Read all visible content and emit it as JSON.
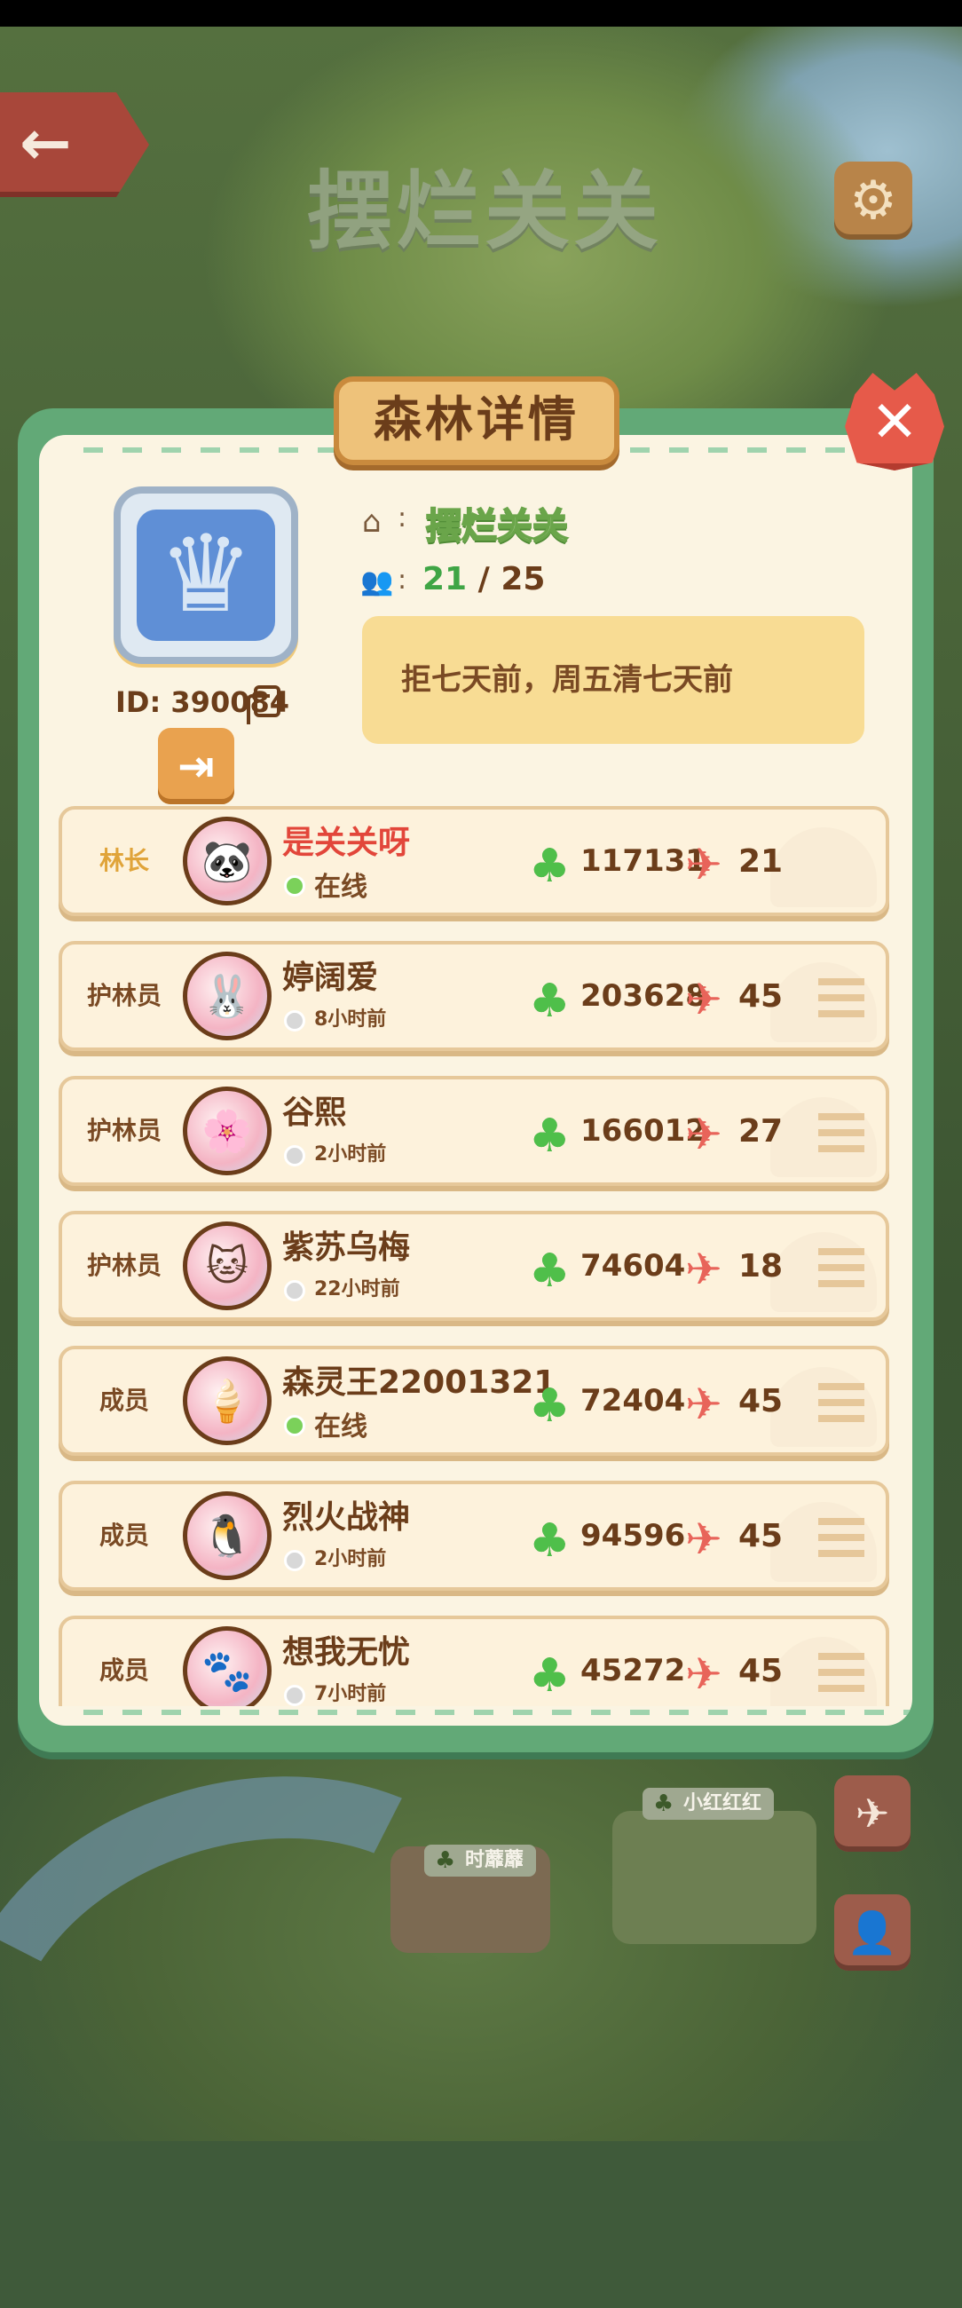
{
  "background": {
    "forest_title": "摆烂关关",
    "map_labels": [
      "小红红红",
      "时蘼蘼"
    ]
  },
  "icons": {
    "back": "back-arrow-icon",
    "settings": "gear-icon",
    "close": "close-icon",
    "home": "home-icon",
    "members": "members-icon",
    "copy": "copy-icon",
    "exit": "exit-icon",
    "clover": "clover-icon",
    "plane": "paper-plane-icon",
    "menu": "menu-icon"
  },
  "modal": {
    "title": "森林详情",
    "forest_id": "ID: 390084",
    "forest_name": "摆烂关关",
    "member_current": "21",
    "member_sep": " / ",
    "member_max": "25",
    "notice": "拒七天前，周五清七天前"
  },
  "members": [
    {
      "role": "林长",
      "name": "是关关呀",
      "status": "在线",
      "online": true,
      "score": "117131",
      "gifts": "21",
      "leader": true
    },
    {
      "role": "护林员",
      "name": "婷阔爱",
      "status": "8小时前",
      "online": false,
      "score": "203628",
      "gifts": "45",
      "leader": false
    },
    {
      "role": "护林员",
      "name": "谷熙",
      "status": "2小时前",
      "online": false,
      "score": "166012",
      "gifts": "27",
      "leader": false
    },
    {
      "role": "护林员",
      "name": "紫苏乌梅",
      "status": "22小时前",
      "online": false,
      "score": "74604",
      "gifts": "18",
      "leader": false
    },
    {
      "role": "成员",
      "name": "森灵王22001321",
      "status": "在线",
      "online": true,
      "score": "72404",
      "gifts": "45",
      "leader": false
    },
    {
      "role": "成员",
      "name": "烈火战神",
      "status": "2小时前",
      "online": false,
      "score": "94596",
      "gifts": "45",
      "leader": false
    },
    {
      "role": "成员",
      "name": "想我无忧",
      "status": "7小时前",
      "online": false,
      "score": "45272",
      "gifts": "45",
      "leader": false
    }
  ],
  "colors": {
    "modal_frame": "#62a977",
    "panel": "#fbf4e2",
    "online": "#7bd15a",
    "leader_name": "#e2463a",
    "member_count": "#3fa545"
  }
}
